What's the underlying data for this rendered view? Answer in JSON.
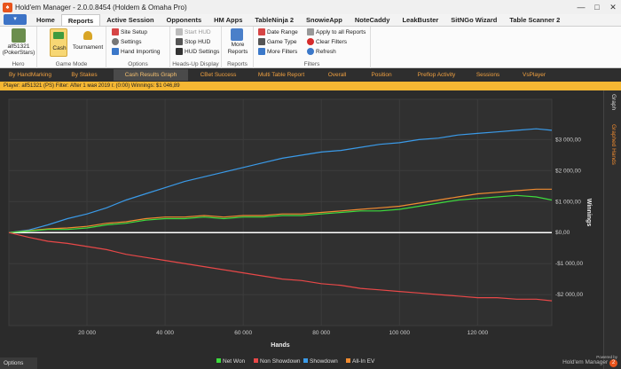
{
  "window": {
    "title": "Hold'em Manager - 2.0.0.8454 (Holdem & Omaha Pro)",
    "minimize": "—",
    "maximize": "□",
    "close": "✕"
  },
  "menu": {
    "file_icon": "▾",
    "tabs": [
      "Home",
      "Reports",
      "Active Session",
      "Opponents",
      "HM Apps",
      "TableNinja 2",
      "SnowieApp",
      "NoteCaddy",
      "LeakBuster",
      "SitNGo Wizard",
      "Table Scanner 2"
    ],
    "active": "Reports"
  },
  "ribbon": {
    "hero": {
      "name": "alf51321",
      "site": "(PokerStars)",
      "label": "Hero"
    },
    "game_mode": {
      "cash": "Cash",
      "tournament": "Tournament",
      "label": "Game Mode"
    },
    "options": {
      "site_setup": "Site Setup",
      "settings": "Settings",
      "hand_importing": "Hand Importing",
      "label": "Options"
    },
    "hud": {
      "start": "Start HUD",
      "stop": "Stop HUD",
      "settings": "HUD Settings",
      "label": "Heads-Up Display"
    },
    "reports": {
      "more": "More",
      "reports": "Reports",
      "label": "Reports"
    },
    "filters": {
      "date_range": "Date Range",
      "game_type": "Game Type",
      "more_filters": "More Filters",
      "apply_all": "Apply to all Reports",
      "clear": "Clear Filters",
      "refresh": "Refresh",
      "label": "Filters"
    }
  },
  "report_tabs": [
    "By HandMarking",
    "By Stakes",
    "Cash Results Graph",
    "CBet Success",
    "Multi Table Report",
    "Overall",
    "Position",
    "Preflop Activity",
    "Sessions",
    "VsPlayer"
  ],
  "active_report_tab": "Cash Results Graph",
  "infobar": "Player: alf51321 (PS)  Filter:  After 1 мая 2019 г. (0:00)  Winnings: $1 046,89",
  "sidebar": {
    "graph": "Graph",
    "graphed_hands": "Graphed Hands"
  },
  "colors": {
    "net_won": "#3ddc3d",
    "non_showdown": "#e84848",
    "showdown": "#3a9ae8",
    "allin_ev": "#f08b30",
    "zero": "#ffffff"
  },
  "chart_data": {
    "type": "line",
    "xlabel": "Hands",
    "ylabel": "Winnings",
    "xlim": [
      0,
      139000
    ],
    "ylim": [
      -3000,
      4300
    ],
    "x_ticks": [
      20000,
      40000,
      60000,
      80000,
      100000,
      120000
    ],
    "x_tick_labels": [
      "20 000",
      "40 000",
      "60 000",
      "80 000",
      "100 000",
      "120 000"
    ],
    "y_ticks": [
      3000,
      2000,
      1000,
      0,
      -1000,
      -2000
    ],
    "y_tick_labels": [
      "$3 000,00",
      "$2 000,00",
      "$1 000,00",
      "$0,00",
      "-$1 000,00",
      "-$2 000,00"
    ],
    "x": [
      0,
      5000,
      10000,
      15000,
      20000,
      25000,
      30000,
      35000,
      40000,
      45000,
      50000,
      55000,
      60000,
      65000,
      70000,
      75000,
      80000,
      85000,
      90000,
      95000,
      100000,
      105000,
      110000,
      115000,
      120000,
      125000,
      130000,
      135000,
      139000
    ],
    "series": [
      {
        "name": "Showdown",
        "values": [
          0,
          80,
          250,
          450,
          600,
          800,
          1050,
          1250,
          1450,
          1650,
          1800,
          1950,
          2100,
          2250,
          2400,
          2500,
          2600,
          2650,
          2750,
          2850,
          2900,
          3000,
          3050,
          3150,
          3200,
          3250,
          3300,
          3350,
          3300
        ]
      },
      {
        "name": "All-In EV",
        "values": [
          0,
          60,
          120,
          150,
          200,
          300,
          350,
          450,
          500,
          500,
          550,
          500,
          550,
          550,
          600,
          600,
          650,
          700,
          750,
          800,
          850,
          950,
          1050,
          1150,
          1250,
          1300,
          1350,
          1400,
          1400
        ]
      },
      {
        "name": "Net Won",
        "values": [
          0,
          50,
          100,
          100,
          150,
          250,
          300,
          400,
          450,
          450,
          500,
          450,
          500,
          500,
          550,
          550,
          600,
          650,
          700,
          700,
          750,
          850,
          950,
          1050,
          1100,
          1150,
          1200,
          1150,
          1050
        ]
      },
      {
        "name": "Non Showdown",
        "values": [
          0,
          -150,
          -280,
          -350,
          -450,
          -550,
          -700,
          -800,
          -900,
          -1000,
          -1100,
          -1200,
          -1300,
          -1400,
          -1500,
          -1550,
          -1650,
          -1700,
          -1800,
          -1850,
          -1900,
          -1950,
          -2000,
          -2050,
          -2100,
          -2100,
          -2150,
          -2150,
          -2200
        ]
      }
    ],
    "legend": [
      "Net Won",
      "Non Showdown",
      "Showdown",
      "All-In EV"
    ],
    "legend_position": "bottom"
  },
  "bottom": {
    "options": "Options",
    "powered_by": "Powered by",
    "brand": "Hold'em Manager",
    "brand_badge": "2"
  }
}
